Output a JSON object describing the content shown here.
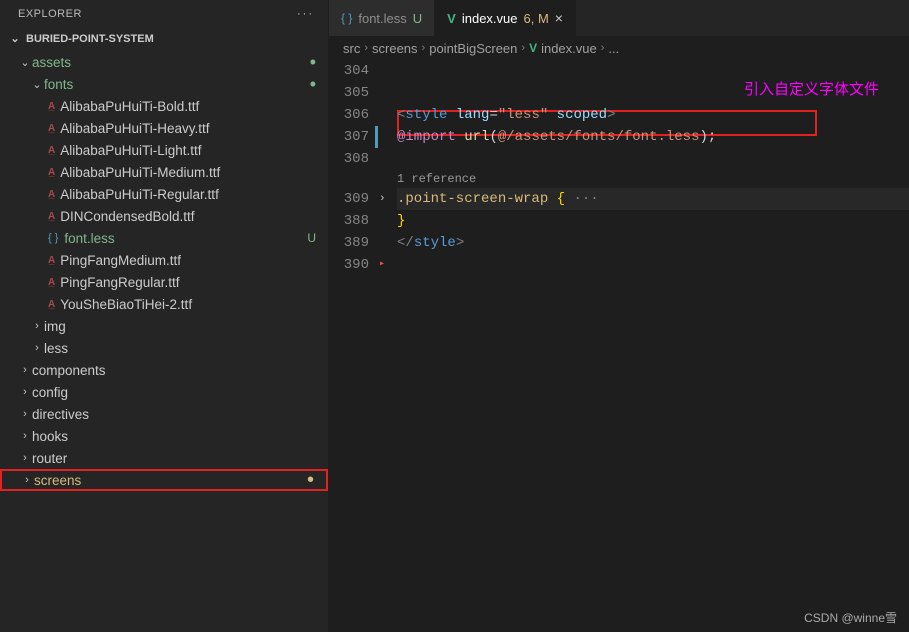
{
  "sidebar": {
    "title": "EXPLORER",
    "project": "BURIED-POINT-SYSTEM",
    "tree": {
      "assets": "assets",
      "fonts": "fonts",
      "files": [
        "AlibabaPuHuiTi-Bold.ttf",
        "AlibabaPuHuiTi-Heavy.ttf",
        "AlibabaPuHuiTi-Light.ttf",
        "AlibabaPuHuiTi-Medium.ttf",
        "AlibabaPuHuiTi-Regular.ttf",
        "DINCondensedBold.ttf",
        "font.less",
        "PingFangMedium.ttf",
        "PingFangRegular.ttf",
        "YouSheBiaoTiHei-2.ttf"
      ],
      "fontless_status": "U",
      "img": "img",
      "less": "less",
      "components": "components",
      "config": "config",
      "directives": "directives",
      "hooks": "hooks",
      "router": "router",
      "screens": "screens"
    }
  },
  "tabs": {
    "fontless": {
      "name": "font.less",
      "status": "U"
    },
    "indexvue": {
      "name": "index.vue",
      "status": "6, M"
    }
  },
  "breadcrumb": {
    "p0": "src",
    "p1": "screens",
    "p2": "pointBigScreen",
    "p3": "index.vue",
    "p4": "..."
  },
  "code": {
    "lines": [
      "304",
      "305",
      "306",
      "307",
      "308",
      "309",
      "388",
      "389",
      "390"
    ],
    "l306": {
      "open": "<",
      "tag": "style",
      "attr1": "lang",
      "val1": "\"less\"",
      "attr2": "scoped",
      "close": ">"
    },
    "l307": {
      "kw": "@import",
      "fn": "url",
      "path": "@/assets/fonts/font.less",
      "end": ";"
    },
    "codelens": "1 reference",
    "l309": {
      "sel": ".point-screen-wrap",
      "brace": "{",
      "dots": " ···"
    },
    "l388": "}",
    "l389": {
      "open": "</",
      "tag": "style",
      "close": ">"
    }
  },
  "annotation": "引入自定义字体文件",
  "watermark": "CSDN @winne雪"
}
